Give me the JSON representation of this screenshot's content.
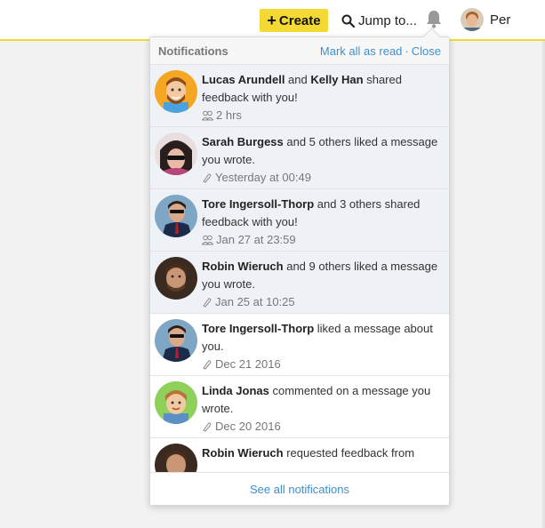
{
  "topbar": {
    "create_label": "Create",
    "create_icon": "plus-icon",
    "jump_label": "Jump to...",
    "jump_icon": "search-icon",
    "bell_icon": "bell-icon",
    "user_name": "Per",
    "accent_color": "#f4d935"
  },
  "panel": {
    "title": "Notifications",
    "mark_all_label": "Mark all as read",
    "separator": "·",
    "close_label": "Close",
    "footer_label": "See all notifications",
    "link_color": "#3d8fd0",
    "unread_bg": "#eef2f6"
  },
  "notifications": [
    {
      "actor1": "Lucas Arundell",
      "joiner": " and ",
      "actor2": "Kelly Han",
      "rest": " shared feedback with you!",
      "time": "2 hrs",
      "icon": "people-icon",
      "unread": true
    },
    {
      "actor1": "Sarah Burgess",
      "rest": " and 5 others liked a message you wrote.",
      "time": "Yesterday at 00:49",
      "icon": "thumbsup-icon",
      "unread": true
    },
    {
      "actor1": "Tore Ingersoll-Thorp",
      "rest": " and 3 others shared feedback with you!",
      "time": "Jan 27 at 23:59",
      "icon": "people-icon",
      "unread": true
    },
    {
      "actor1": "Robin Wieruch",
      "rest": " and 9 others liked a message you wrote.",
      "time": "Jan 25 at 10:25",
      "icon": "thumbsup-icon",
      "unread": true
    },
    {
      "actor1": "Tore Ingersoll-Thorp",
      "rest": " liked a message about you.",
      "time": "Dec 21 2016",
      "icon": "thumbsup-icon",
      "unread": false
    },
    {
      "actor1": "Linda Jonas",
      "rest": " commented on a message you wrote.",
      "time": "Dec 20 2016",
      "icon": "thumbsup-icon",
      "unread": false
    },
    {
      "actor1": "Robin Wieruch",
      "rest": " requested feedback from",
      "time": "",
      "icon": "",
      "unread": false
    }
  ]
}
